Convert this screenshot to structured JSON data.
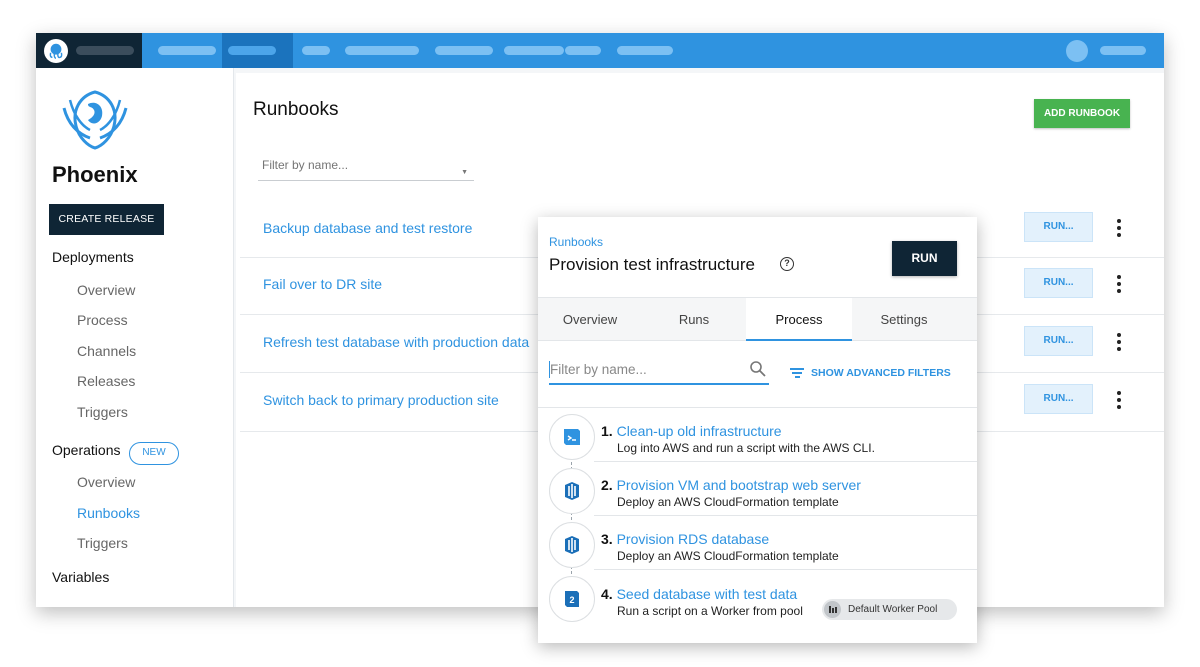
{
  "topbar": {
    "nav_pill_count": 9
  },
  "sidebar": {
    "project_name": "Phoenix",
    "create_release": "CREATE RELEASE",
    "deployments": "Deployments",
    "deployment_items": [
      "Overview",
      "Process",
      "Channels",
      "Releases",
      "Triggers"
    ],
    "operations": "Operations",
    "new_badge": "NEW",
    "operation_items": [
      "Overview",
      "Runbooks",
      "Triggers"
    ],
    "active_item": "Runbooks",
    "variables": "Variables"
  },
  "main": {
    "title": "Runbooks",
    "add_runbook": "ADD RUNBOOK",
    "filter_placeholder": "Filter by name...",
    "run_label": "RUN...",
    "runbooks": [
      "Backup database and test restore",
      "Fail over to DR site",
      "Refresh test database with production data",
      "Switch back to primary production site"
    ]
  },
  "popup": {
    "breadcrumb": "Runbooks",
    "title": "Provision test infrastructure",
    "help": "?",
    "run": "RUN",
    "tabs": [
      "Overview",
      "Runs",
      "Process",
      "Settings"
    ],
    "active_tab": "Process",
    "filter_placeholder": "Filter by name...",
    "advanced_filters": "SHOW ADVANCED FILTERS",
    "steps": [
      {
        "num": "1.",
        "title": "Clean-up old infrastructure",
        "desc": "Log into AWS and run a script with the AWS CLI.",
        "icon": "aws-cli-script-icon"
      },
      {
        "num": "2.",
        "title": "Provision VM and bootstrap web server",
        "desc": "Deploy an AWS CloudFormation template",
        "icon": "cloudformation-icon"
      },
      {
        "num": "3.",
        "title": "Provision RDS database",
        "desc": "Deploy an AWS CloudFormation template",
        "icon": "cloudformation-icon"
      },
      {
        "num": "4.",
        "title": "Seed database with test data",
        "desc": "Run a script on a Worker from pool",
        "icon": "script-icon"
      }
    ],
    "worker_pool": "Default Worker Pool"
  },
  "colors": {
    "accent": "#2f93e0",
    "dark": "#0f2535",
    "green": "#48b350"
  }
}
